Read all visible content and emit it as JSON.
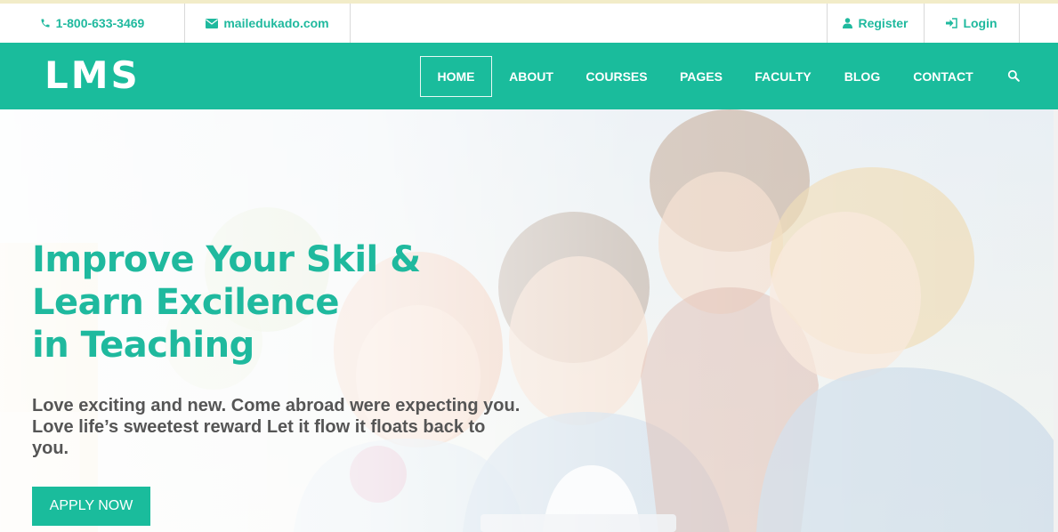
{
  "topbar": {
    "phone": "1-800-633-3469",
    "email": "mailedukado.com",
    "register_label": "Register",
    "login_label": "Login"
  },
  "nav": {
    "logo": "LMS",
    "items": [
      {
        "label": "HOME",
        "active": true
      },
      {
        "label": "ABOUT"
      },
      {
        "label": "COURSES"
      },
      {
        "label": "PAGES"
      },
      {
        "label": "FACULTY"
      },
      {
        "label": "BLOG"
      },
      {
        "label": "CONTACT"
      }
    ],
    "search_icon": "search-icon"
  },
  "hero": {
    "headline_lines": [
      "Improve Your Skil &",
      "Learn Excilence",
      "in Teaching"
    ],
    "subtext_lines": [
      "Love exciting and new. Come abroad were expecting you.",
      "Love life’s sweetest reward Let it flow it floats back to",
      "you."
    ],
    "button_label": "APPLY NOW"
  },
  "colors": {
    "brand": "#1abc9c",
    "brand_text": "#1fb99e",
    "body_text": "#555555"
  }
}
